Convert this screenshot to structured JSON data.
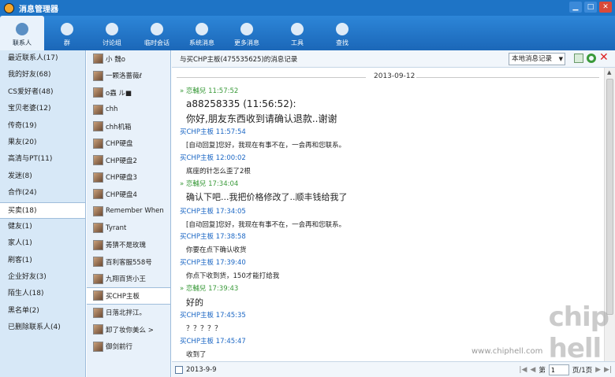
{
  "window": {
    "title": "消息管理器"
  },
  "toolbar": {
    "items": [
      {
        "label": "联系人",
        "icon": "contacts-icon"
      },
      {
        "label": "群",
        "icon": "group-icon"
      },
      {
        "label": "讨论组",
        "icon": "discussion-icon"
      },
      {
        "label": "临时会话",
        "icon": "temp-chat-icon"
      },
      {
        "label": "系统消息",
        "icon": "speaker-icon"
      },
      {
        "label": "更多消息",
        "icon": "more-icon"
      },
      {
        "label": "工具",
        "icon": "wrench-icon"
      },
      {
        "label": "查找",
        "icon": "search-icon"
      }
    ]
  },
  "nav": {
    "items": [
      "最近联系人(17)",
      "我的好友(68)",
      "CS爱好者(48)",
      "宝贝老婆(12)",
      "传奇(19)",
      "果友(20)",
      "高清与PT(11)",
      "发迷(8)",
      "合作(24)",
      "买卖(18)",
      "健友(1)",
      "家人(1)",
      "刷客(1)",
      "企业好友(3)",
      "陌生人(18)",
      "黑名单(2)",
      "已删除联系人(4)"
    ]
  },
  "contacts": {
    "items": [
      "小 魏o",
      "一颗洛蔷薇ℓ",
      "o蟲 ル■",
      "chh",
      "chh机箱",
      "CHP硬盘",
      "CHP硬盘2",
      "CHP硬盘3",
      "CHP硬盘4",
      "Remember When",
      "Tyrant",
      "莠猜不是玫瑰",
      "百利客服558号",
      "九翔百货小王",
      "买CHP主板",
      "日落北拌江。",
      "卸了妆你美么 >",
      "御剑前行"
    ]
  },
  "chat": {
    "header_title": "与买CHP主板(475535625)的消息记录",
    "scope_select": "本地消息记录",
    "date": "2013-09-12",
    "messages": [
      {
        "sender": "» 恋輔兒",
        "time": "11:57:52",
        "lines": [
          "a88258335 (11:56:52):",
          "你好,朋友东西收到请确认退款..谢谢"
        ]
      },
      {
        "sender": "买CHP主板",
        "time": "11:57:54",
        "lines": [
          "[自动回复]您好，我现在有事不在，一会再和您联系。"
        ]
      },
      {
        "sender": "买CHP主板",
        "time": "12:00:02",
        "lines": [
          "底座的针怎么歪了2根"
        ]
      },
      {
        "sender": "» 恋輔兒",
        "time": "17:34:04",
        "lines": [
          "确认下吧...我把价格修改了..顺丰钱给我了"
        ]
      },
      {
        "sender": "买CHP主板",
        "time": "17:34:05",
        "lines": [
          "[自动回复]您好，我现在有事不在，一会再和您联系。"
        ]
      },
      {
        "sender": "买CHP主板",
        "time": "17:38:58",
        "lines": [
          "你要在点下确认收货"
        ]
      },
      {
        "sender": "买CHP主板",
        "time": "17:39:40",
        "lines": [
          "你点下收到货，150才能打给我"
        ]
      },
      {
        "sender": "» 恋輔兒",
        "time": "17:39:43",
        "lines": [
          "好的"
        ]
      },
      {
        "sender": "买CHP主板",
        "time": "17:45:35",
        "lines": [
          "？？？？？"
        ]
      },
      {
        "sender": "买CHP主板",
        "time": "17:45:47",
        "lines": [
          "收到了"
        ]
      }
    ]
  },
  "footer": {
    "date": "2013-9-9",
    "page_prefix": "第",
    "page_value": "1",
    "page_suffix": "页/1页"
  },
  "watermark": {
    "logo": "chip hell",
    "url": "www.chiphell.com"
  },
  "colors": {
    "title_bar": "#1e74c6",
    "self_sender": "#3a9a3a",
    "other_sender": "#1a66c4"
  }
}
